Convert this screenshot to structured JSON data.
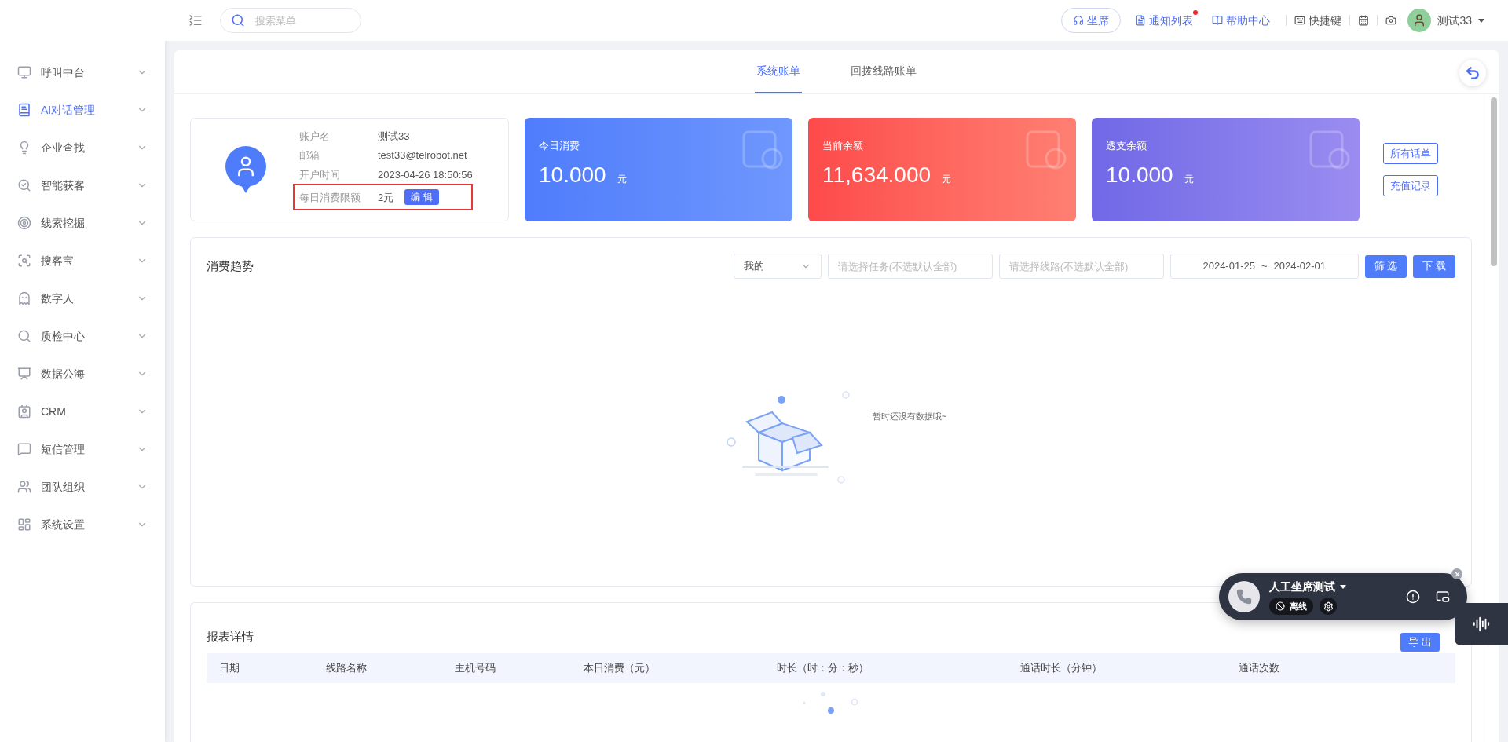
{
  "sidebar": {
    "items": [
      {
        "label": "呼叫中台",
        "selected": false
      },
      {
        "label": "AI对话管理",
        "selected": true
      },
      {
        "label": "企业查找",
        "selected": false
      },
      {
        "label": "智能获客",
        "selected": false
      },
      {
        "label": "线索挖掘",
        "selected": false
      },
      {
        "label": "搜客宝",
        "selected": false
      },
      {
        "label": "数字人",
        "selected": false
      },
      {
        "label": "质检中心",
        "selected": false
      },
      {
        "label": "数据公海",
        "selected": false
      },
      {
        "label": "CRM",
        "selected": false
      },
      {
        "label": "短信管理",
        "selected": false
      },
      {
        "label": "团队组织",
        "selected": false
      },
      {
        "label": "系统设置",
        "selected": false
      }
    ]
  },
  "topbar": {
    "search": {
      "placeholder": "搜索菜单"
    },
    "seat_button": "坐席",
    "links": [
      {
        "label": "通知列表",
        "badge": true
      },
      {
        "label": "帮助中心",
        "badge": false
      }
    ],
    "shortcut": "快捷键",
    "user": "测试33"
  },
  "tabs": [
    {
      "label": "系统账单",
      "selected": true
    },
    {
      "label": "回拨线路账单",
      "selected": false
    }
  ],
  "account": {
    "rows": [
      {
        "label": "账户名",
        "value": "测试33"
      },
      {
        "label": "邮箱",
        "value": "test33@telrobot.net"
      },
      {
        "label": "开户时间",
        "value": "2023-04-26 18:50:56"
      }
    ],
    "daily_limit": {
      "label": "每日消费限额",
      "value": "2元",
      "button": "编 辑"
    }
  },
  "stats": [
    {
      "kind": "blue",
      "label": "今日消费",
      "value": "10.000",
      "unit": "元"
    },
    {
      "kind": "red",
      "label": "当前余额",
      "value": "11,634.000",
      "unit": "元"
    },
    {
      "kind": "purple",
      "label": "透支余额",
      "value": "10.000",
      "unit": "元"
    }
  ],
  "side_buttons": [
    "所有话单",
    "充值记录"
  ],
  "trend": {
    "title": "消费趋势",
    "select": {
      "value": "我的"
    },
    "task_field": {
      "placeholder": "请选择任务(不选默认全部)"
    },
    "line_field": {
      "placeholder": "请选择线路(不选默认全部)"
    },
    "date_range": {
      "start": "2024-01-25",
      "separator": "~",
      "end": "2024-02-01"
    },
    "buttons": [
      "筛 选",
      "下 载"
    ],
    "empty_text": "暂时还没有数据哦~"
  },
  "report": {
    "title": "报表详情",
    "export_button": "导 出",
    "columns": [
      "日期",
      "线路名称",
      "主机号码",
      "本日消费（元）",
      "时长（时：分：秒）",
      "通话时长（分钟）",
      "通话次数"
    ]
  },
  "call_widget": {
    "title": "人工坐席测试",
    "status": "离线"
  }
}
